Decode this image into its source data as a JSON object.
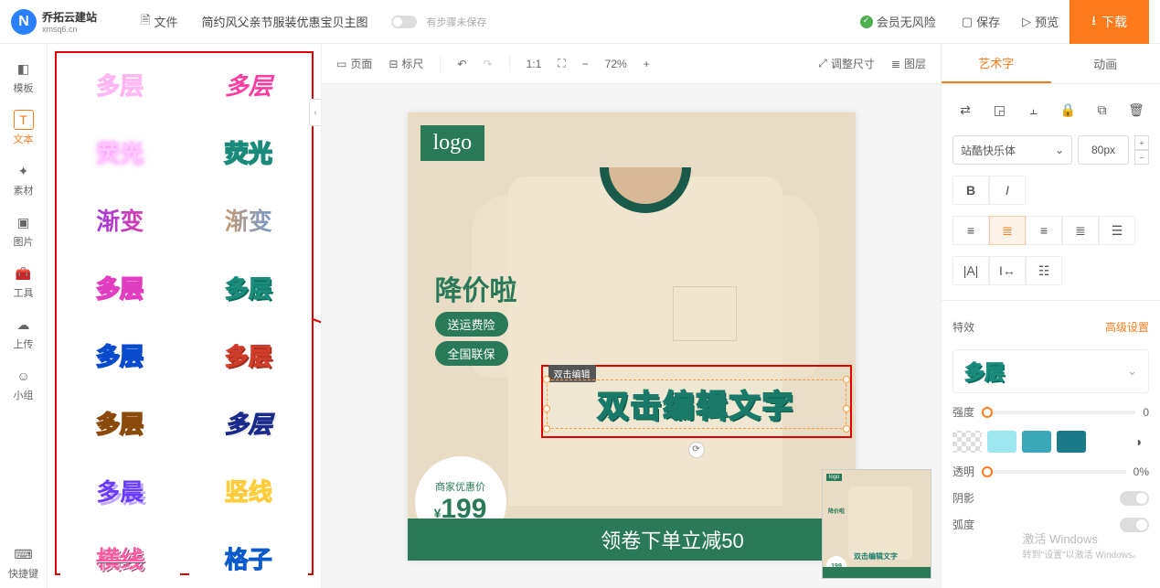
{
  "brand": {
    "name": "乔拓云建站",
    "sub": "xmsq6.cn",
    "initial": "N"
  },
  "top": {
    "file": "文件",
    "doc_title": "简约风父亲节服装优惠宝贝主图",
    "autosave": "有步骤未保存",
    "safe": "会员无风险",
    "save": "保存",
    "preview": "预览",
    "download": "下载"
  },
  "rail": [
    {
      "icon": "◧",
      "label": "模板"
    },
    {
      "icon": "T",
      "label": "文本"
    },
    {
      "icon": "✦",
      "label": "素材"
    },
    {
      "icon": "▣",
      "label": "图片"
    },
    {
      "icon": "🧰",
      "label": "工具"
    },
    {
      "icon": "☁",
      "label": "上传"
    },
    {
      "icon": "☺",
      "label": "小组"
    }
  ],
  "rail_bottom": {
    "icon": "⌨",
    "label": "快捷键"
  },
  "styles": [
    "多层",
    "多层",
    "荧光",
    "荧光",
    "渐变",
    "渐变",
    "多层",
    "多层",
    "多层",
    "多层",
    "多层",
    "多层",
    "多晨",
    "竖线",
    "横线",
    "格子"
  ],
  "canvas_toolbar": {
    "page": "页面",
    "ruler": "标尺",
    "ratio": "1:1",
    "zoom": "72%",
    "resize": "调整尺寸",
    "layers": "图层"
  },
  "artboard": {
    "logo": "logo",
    "headline": "降价啦",
    "pill1": "送运费险",
    "pill2": "全国联保",
    "price_label": "商家优惠价",
    "price_currency": "¥",
    "price_value": "199",
    "banner": "领卷下单立减50",
    "sel_hint": "双击编辑",
    "sel_text": "双击编辑文字"
  },
  "props": {
    "tab_art": "艺术字",
    "tab_anim": "动画",
    "font": "站酷快乐体",
    "size": "80px",
    "section_fx": "特效",
    "advanced": "高级设置",
    "fx_sample": "多层",
    "intensity": "强度",
    "intensity_val": "0",
    "opacity": "透明",
    "opacity_val": "0%",
    "shadow": "阴影",
    "radius": "弧度",
    "colors": [
      "#ffffff",
      "#9de8f0",
      "#3aa8b8",
      "#1a7a8a"
    ]
  },
  "watermark": {
    "line1": "激活 Windows",
    "line2": "转到\"设置\"以激活 Windows。"
  }
}
